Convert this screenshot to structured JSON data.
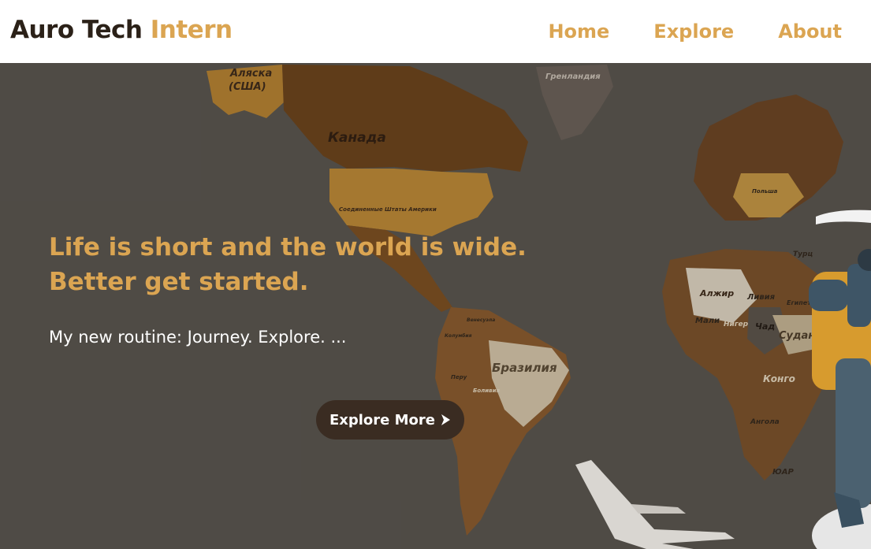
{
  "theme": {
    "accent": "#dba552",
    "dark": "#2b2118",
    "button_bg": "#3a2c22"
  },
  "navbar": {
    "brand_primary": "Auro Tech",
    "brand_accent": "Intern",
    "links": [
      {
        "label": "Home"
      },
      {
        "label": "Explore"
      },
      {
        "label": "About"
      }
    ]
  },
  "hero": {
    "headline_line1": "Life is short and the world is wide.",
    "headline_line2": "Better get started.",
    "subtitle": "My new routine: Journey. Explore. ...",
    "cta_label": "Explore More",
    "cta_icon": "chevron-right-icon"
  },
  "map_labels": {
    "alaska_line1": "Аляска",
    "alaska_line2": "(США)",
    "greenland": "Гренландия",
    "canada": "Канада",
    "usa": "Соединенные Штаты Америки",
    "brazil": "Бразилия",
    "algeria": "Алжир",
    "libya": "Ливия",
    "mali": "Мали",
    "niger": "Нигер",
    "chad": "Чад",
    "sudan": "Судан",
    "congo": "Конго",
    "angola": "Ангола",
    "south_africa": "ЮАР",
    "egypt": "Египет",
    "poland": "Польша",
    "turkey": "Турц",
    "peru": "Перу",
    "bolivia": "Боливия",
    "venezuela": "Венесуэла",
    "colombia": "Колумбия"
  }
}
